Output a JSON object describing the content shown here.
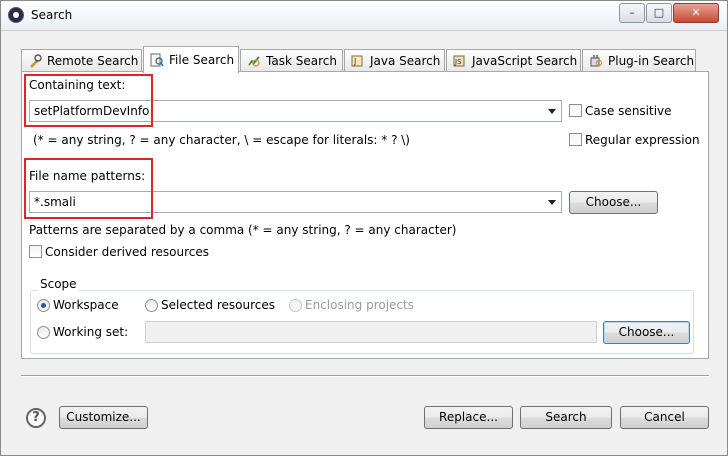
{
  "window": {
    "title": "Search",
    "controls": {
      "minimize": "–",
      "maximize": "□",
      "close": "✕"
    }
  },
  "tabs": [
    {
      "label": "Remote Search",
      "icon": "remote-search-icon"
    },
    {
      "label": "File Search",
      "icon": "file-search-icon",
      "active": true
    },
    {
      "label": "Task Search",
      "icon": "task-search-icon"
    },
    {
      "label": "Java Search",
      "icon": "java-search-icon"
    },
    {
      "label": "JavaScript Search",
      "icon": "javascript-search-icon"
    },
    {
      "label": "Plug-in Search",
      "icon": "plugin-search-icon"
    }
  ],
  "containing_text": {
    "label": "Containing text:",
    "value": "setPlatformDevInfo",
    "hint": "(* = any string, ? = any character, \\ = escape for literals: * ? \\)"
  },
  "options": {
    "case_sensitive": "Case sensitive",
    "regular_expression": "Regular expression"
  },
  "file_name_patterns": {
    "label": "File name patterns:",
    "value": "*.smali",
    "choose_label": "Choose...",
    "hint": "Patterns are separated by a comma (* = any string, ? = any character)"
  },
  "derived": {
    "label": "Consider derived resources"
  },
  "scope": {
    "title": "Scope",
    "workspace": "Workspace",
    "selected_resources": "Selected resources",
    "enclosing_projects": "Enclosing projects",
    "working_set": "Working set:",
    "choose_label": "Choose...",
    "selected": "Workspace"
  },
  "footer": {
    "customize": "Customize...",
    "replace": "Replace...",
    "search": "Search",
    "cancel": "Cancel"
  },
  "colors": {
    "highlight_box": "#e0242c",
    "radio_selected": "#1f58a8"
  }
}
